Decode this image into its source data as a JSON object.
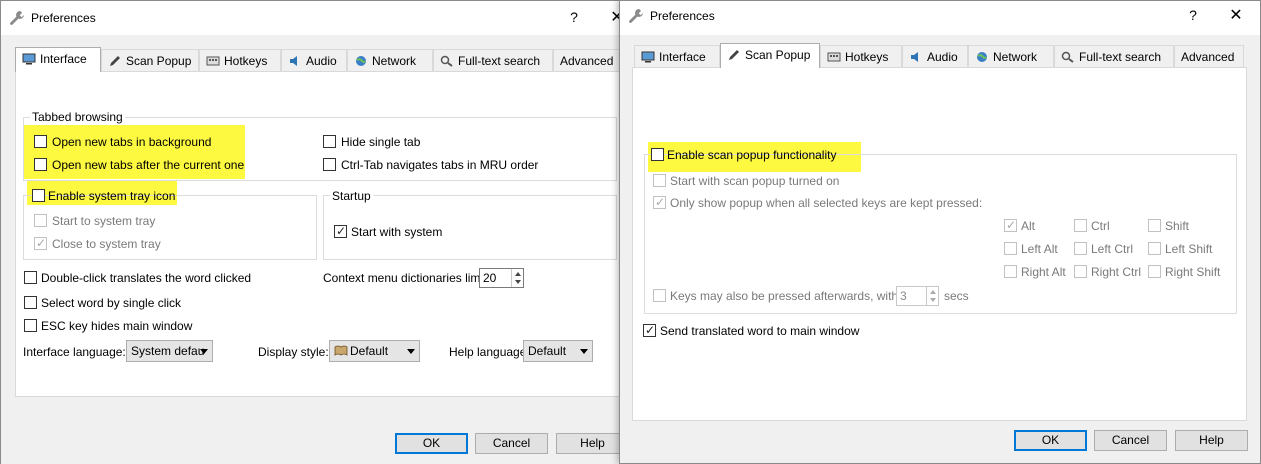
{
  "left": {
    "title": "Preferences",
    "help": "?",
    "close": "✕",
    "tabs": [
      "Interface",
      "Scan Popup",
      "Hotkeys",
      "Audio",
      "Network",
      "Full-text search",
      "Advanced"
    ],
    "tabbed_browsing": "Tabbed browsing",
    "open_bg": "Open new tabs in background",
    "open_after": "Open new tabs after the current one",
    "hide_single": "Hide single tab",
    "ctrl_tab": "Ctrl-Tab navigates tabs in MRU order",
    "tray_icon": "Enable system tray icon",
    "start_tray": "Start to system tray",
    "close_tray": "Close to system tray",
    "startup": "Startup",
    "start_system": "Start with system",
    "dblclick": "Double-click translates the word clicked",
    "ctx_label": "Context menu dictionaries limit:",
    "ctx_value": "20",
    "select_word": "Select word by single click",
    "esc_hides": "ESC key hides main window",
    "iface_lang_label": "Interface language:",
    "iface_lang_value": "System defau",
    "display_style_label": "Display style:",
    "display_style_value": "Default",
    "help_lang_label": "Help language",
    "help_lang_value": "Default",
    "ok": "OK",
    "cancel": "Cancel",
    "help_btn": "Help"
  },
  "right": {
    "title": "Preferences",
    "help": "?",
    "close": "✕",
    "tabs": [
      "Interface",
      "Scan Popup",
      "Hotkeys",
      "Audio",
      "Network",
      "Full-text search",
      "Advanced"
    ],
    "enable_scan": "Enable scan popup functionality",
    "start_scan": "Start with scan popup turned on",
    "only_show": "Only show popup when all selected keys are kept pressed:",
    "keys": [
      "Alt",
      "Ctrl",
      "Shift",
      "Left Alt",
      "Left Ctrl",
      "Left Shift",
      "Right Alt",
      "Right Ctrl",
      "Right Shift"
    ],
    "keys_after": "Keys may also be pressed afterwards, within",
    "secs_value": "3",
    "secs": "secs",
    "send_word": "Send translated word to main window",
    "ok": "OK",
    "cancel": "Cancel",
    "help_btn": "Help"
  },
  "colors": {
    "highlight": "#fdf82b",
    "default_button_border": "#0078d7",
    "panel": "#ffffff",
    "dialog": "#f0f0f0"
  },
  "icons": [
    "wrench-icon",
    "monitor-icon",
    "pen-icon",
    "keyboard-icon",
    "speaker-icon",
    "globe-icon",
    "magnifier-icon",
    "book-icon"
  ]
}
